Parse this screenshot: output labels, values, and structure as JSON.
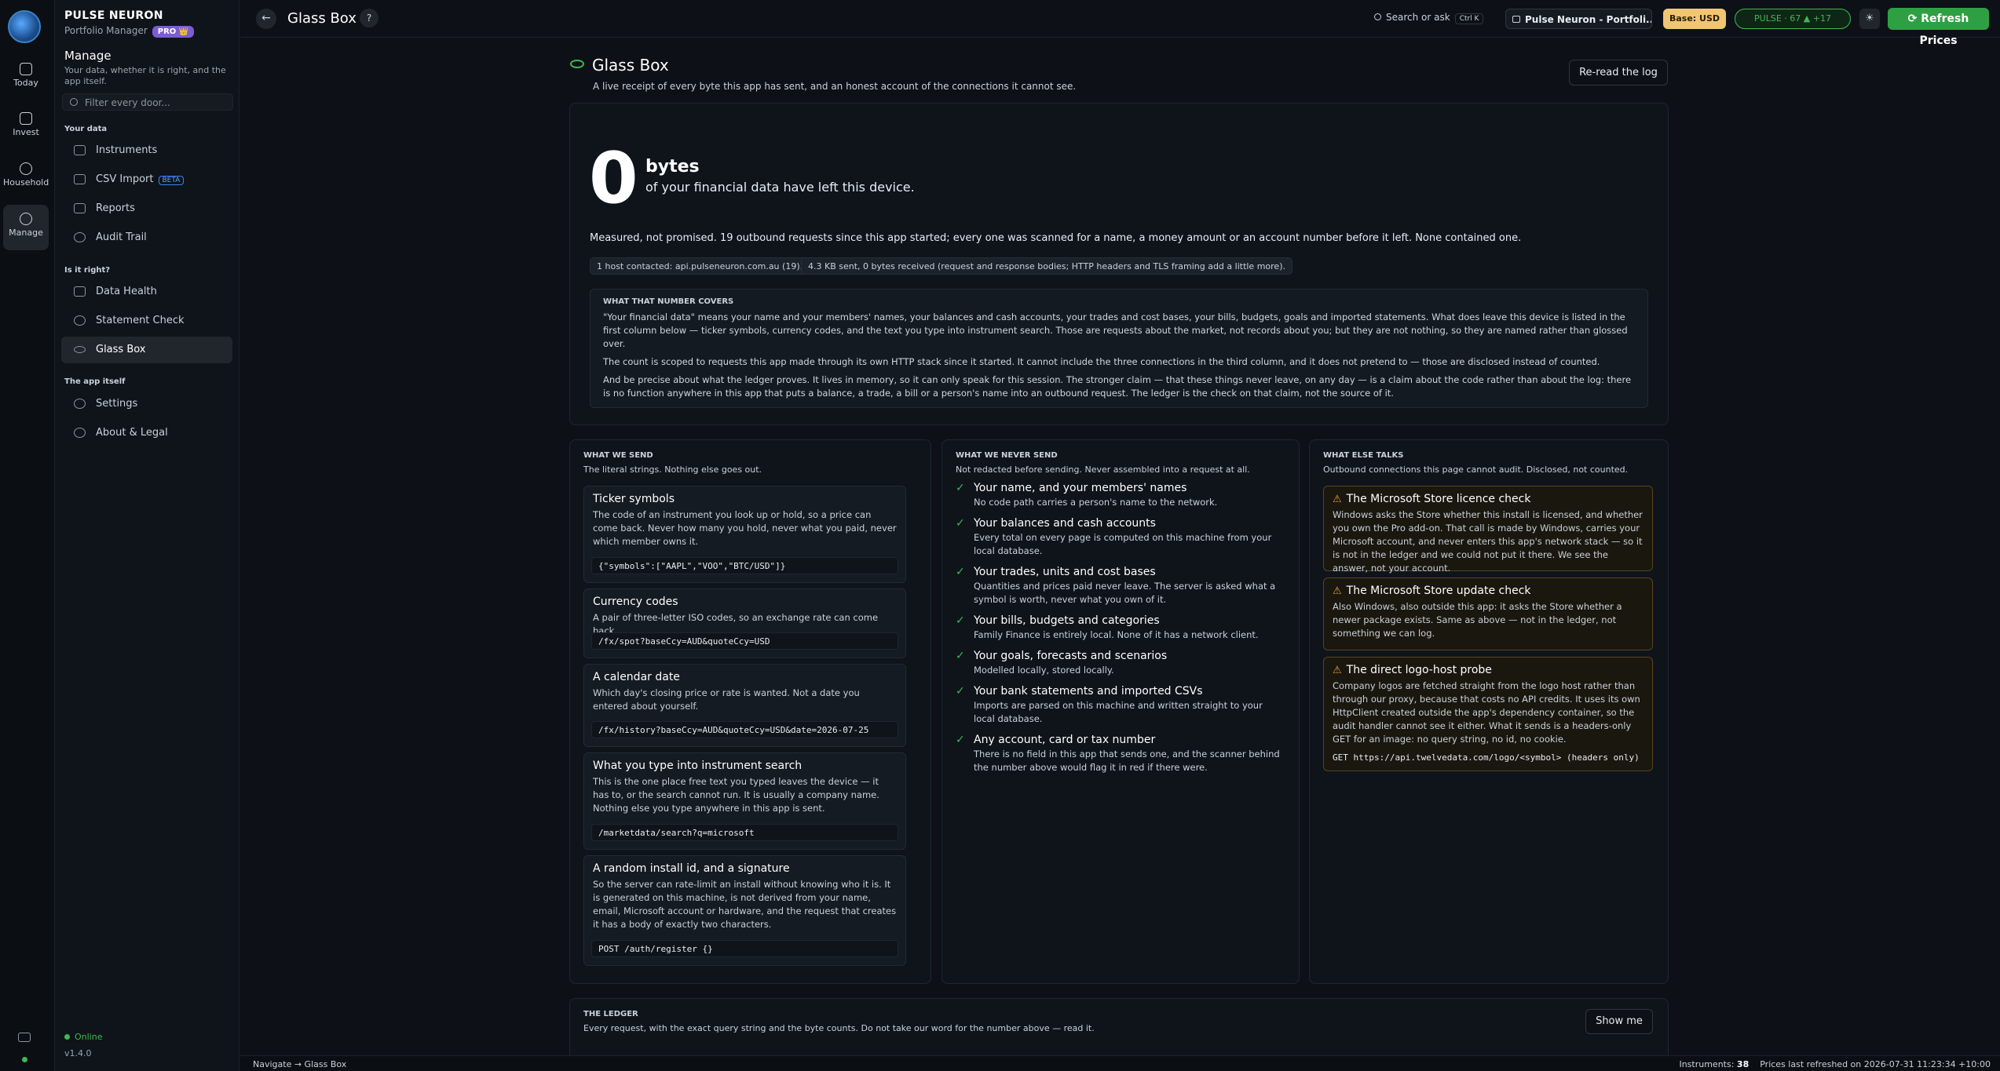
{
  "app": {
    "name": "PULSE NEURON",
    "subtitle": "Portfolio Manager",
    "badge": "PRO 👑",
    "version": "v1.4.0",
    "status": "Online"
  },
  "rail": [
    {
      "label": "Today",
      "icon": "calendar-icon"
    },
    {
      "label": "Invest",
      "icon": "chart-icon"
    },
    {
      "label": "Household",
      "icon": "people-icon"
    },
    {
      "label": "Manage",
      "icon": "gear-icon"
    }
  ],
  "sidebar": {
    "title": "Manage",
    "description": "Your data, whether it is right, and the app itself.",
    "filter_placeholder": "Filter every door...",
    "sections": [
      {
        "title": "Your data",
        "items": [
          {
            "label": "Instruments",
            "icon": "folder-icon"
          },
          {
            "label": "CSV Import",
            "badge": "BETA",
            "icon": "download-icon"
          },
          {
            "label": "Reports",
            "icon": "document-icon"
          },
          {
            "label": "Audit Trail",
            "icon": "history-icon"
          }
        ]
      },
      {
        "title": "Is it right?",
        "items": [
          {
            "label": "Data Health",
            "icon": "heart-icon"
          },
          {
            "label": "Statement Check",
            "icon": "check-circle-icon"
          },
          {
            "label": "Glass Box",
            "icon": "eye-icon"
          }
        ]
      },
      {
        "title": "The app itself",
        "items": [
          {
            "label": "Settings",
            "icon": "gear-icon"
          },
          {
            "label": "About & Legal",
            "icon": "info-icon"
          }
        ]
      }
    ]
  },
  "topbar": {
    "title": "Glass Box",
    "help": "?",
    "search": "Search or ask",
    "search_kbd": "Ctrl K",
    "portfolio": "Pulse Neuron - Portfoli...",
    "base": "Base: USD",
    "pulse": "PULSE · 67  ▲ +17",
    "refresh": "Refresh Prices"
  },
  "page": {
    "title": "Glass Box",
    "subtitle": "A live receipt of every byte this app has sent, and an honest account of the connections it cannot see.",
    "reread": "Re-read the log",
    "big_number": "0",
    "unit": "bytes",
    "unit_sub": "of your financial data have left this device.",
    "measured": "Measured, not promised. 19 outbound requests since this app started; every one was scanned for a name, a money amount or an account number before it left. None contained one.",
    "pills": [
      "1 host contacted: api.pulseneuron.com.au (19).",
      "4.3 KB sent, 0 bytes received (request and response bodies; HTTP headers and TLS framing add a little more)."
    ],
    "covers_title": "WHAT THAT NUMBER COVERS",
    "covers_p1": "\"Your financial data\" means your name and your members' names, your balances and cash accounts, your trades and cost bases, your bills, budgets, goals and imported statements. What does leave this device is listed in the first column below — ticker symbols, currency codes, and the text you type into instrument search. Those are requests about the market, not records about you; but they are not nothing, so they are named rather than glossed over.",
    "covers_p2": "The count is scoped to requests this app made through its own HTTP stack since it started. It cannot include the three connections in the third column, and it does not pretend to — those are disclosed instead of counted.",
    "covers_p3": "And be precise about what the ledger proves. It lives in memory, so it can only speak for this session. The stronger claim — that these things never leave, on any day — is a claim about the code rather than about the log: there is no function anywhere in this app that puts a balance, a trade, a bill or a person's name into an outbound request. The ledger is the check on that claim, not the source of it."
  },
  "send": {
    "title": "WHAT WE SEND",
    "subtitle": "The literal strings. Nothing else goes out.",
    "items": [
      {
        "title": "Ticker symbols",
        "desc": "The code of an instrument you look up or hold, so a price can come back. Never how many you hold, never what you paid, never which member owns it.",
        "code": "{\"symbols\":[\"AAPL\",\"VOO\",\"BTC/USD\"]}"
      },
      {
        "title": "Currency codes",
        "desc": "A pair of three-letter ISO codes, so an exchange rate can come back.",
        "code": "/fx/spot?baseCcy=AUD&quoteCcy=USD"
      },
      {
        "title": "A calendar date",
        "desc": "Which day's closing price or rate is wanted. Not a date you entered about yourself.",
        "code": "/fx/history?baseCcy=AUD&quoteCcy=USD&date=2026-07-25"
      },
      {
        "title": "What you type into instrument search",
        "desc": "This is the one place free text you typed leaves the device — it has to, or the search cannot run. It is usually a company name. Nothing else you type anywhere in this app is sent.",
        "code": "/marketdata/search?q=microsoft"
      },
      {
        "title": "A random install id, and a signature",
        "desc": "So the server can rate-limit an install without knowing who it is. It is generated on this machine, is not derived from your name, email, Microsoft account or hardware, and the request that creates it has a body of exactly two characters.",
        "code": "POST /auth/register  {}"
      }
    ]
  },
  "never": {
    "title": "WHAT WE NEVER SEND",
    "subtitle": "Not redacted before sending. Never assembled into a request at all.",
    "items": [
      {
        "title": "Your name, and your members' names",
        "desc": "No code path carries a person's name to the network."
      },
      {
        "title": "Your balances and cash accounts",
        "desc": "Every total on every page is computed on this machine from your local database."
      },
      {
        "title": "Your trades, units and cost bases",
        "desc": "Quantities and prices paid never leave. The server is asked what a symbol is worth, never what you own of it."
      },
      {
        "title": "Your bills, budgets and categories",
        "desc": "Family Finance is entirely local. None of it has a network client."
      },
      {
        "title": "Your goals, forecasts and scenarios",
        "desc": "Modelled locally, stored locally."
      },
      {
        "title": "Your bank statements and imported CSVs",
        "desc": "Imports are parsed on this machine and written straight to your local database."
      },
      {
        "title": "Any account, card or tax number",
        "desc": "There is no field in this app that sends one, and the scanner behind the number above would flag it in red if there were."
      }
    ]
  },
  "talks": {
    "title": "WHAT ELSE TALKS",
    "subtitle": "Outbound connections this page cannot audit. Disclosed, not counted.",
    "items": [
      {
        "title": "The Microsoft Store licence check",
        "desc": "Windows asks the Store whether this install is licensed, and whether you own the Pro add-on. That call is made by Windows, carries your Microsoft account, and never enters this app's network stack — so it is not in the ledger and we could not put it there. We see the answer, not your account.",
        "code": ""
      },
      {
        "title": "The Microsoft Store update check",
        "desc": "Also Windows, also outside this app: it asks the Store whether a newer package exists. Same as above — not in the ledger, not something we can log.",
        "code": ""
      },
      {
        "title": "The direct logo-host probe",
        "desc": "Company logos are fetched straight from the logo host rather than through our proxy, because that costs no API credits. It uses its own HttpClient created outside the app's dependency container, so the audit handler cannot see it either. What it sends is a headers-only GET for an image: no query string, no id, no cookie.",
        "code": "GET https://api.twelvedata.com/logo/<symbol>  (headers only)"
      }
    ]
  },
  "ledger": {
    "title": "THE LEDGER",
    "subtitle": "Every request, with the exact query string and the byte counts. Do not take our word for the number above — read it.",
    "button": "Show me"
  },
  "statusbar": {
    "left": "Navigate → Glass Box",
    "instruments_label": "Instruments:",
    "instruments_value": "38",
    "refreshed": "Prices last refreshed on 2026-07-31 11:23:34 +10:00"
  }
}
